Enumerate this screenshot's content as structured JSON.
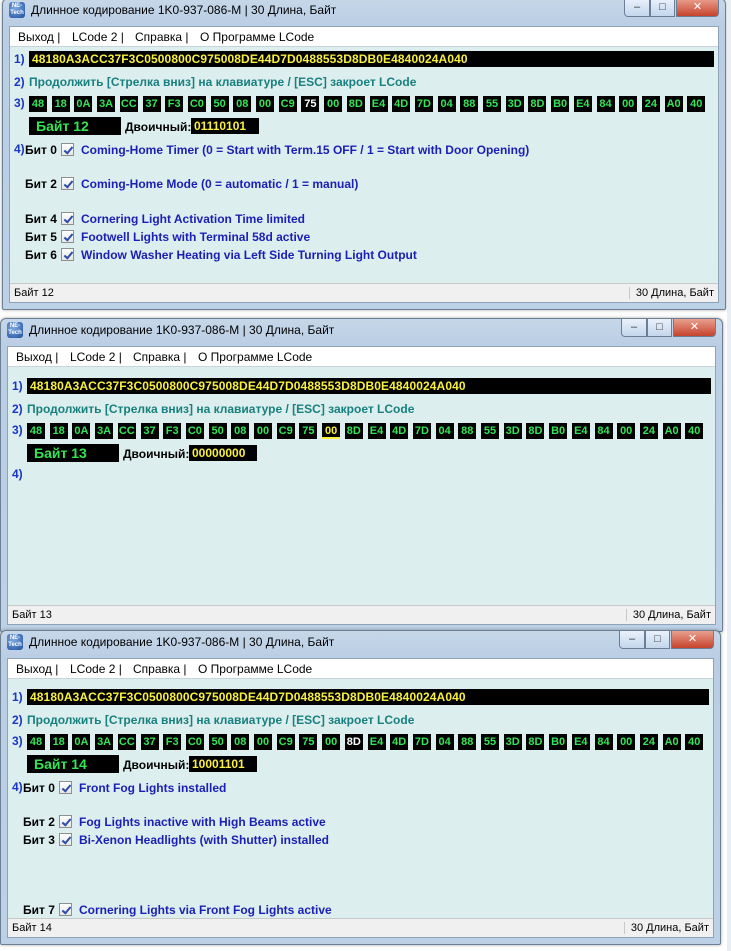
{
  "app": {
    "logo_text": "NE-Tech",
    "title": "Длинное кодирование  1K0-937-086-M | 30 Длина, Байт",
    "controls": {
      "minimize": "–",
      "maximize": "□",
      "close": "✕"
    }
  },
  "menu": {
    "file": "Выход |",
    "lcode2": "LCode 2 |",
    "help": "Справка |",
    "about": "О Программе LCode"
  },
  "labels": {
    "step1": "1)",
    "step2": "2)",
    "step3": "3)",
    "step4": "4)",
    "hint": "Продолжить [Стрелка вниз] на клавиатуре / [ESC] закроет LCode",
    "binary": "Двоичный:",
    "status_right": "30 Длина, Байт"
  },
  "coding_string": "48180A3ACC37F3C0500800C975008DE44D7D0488553D8DB0E4840024A040",
  "bytes": [
    "48",
    "18",
    "0A",
    "3A",
    "CC",
    "37",
    "F3",
    "C0",
    "50",
    "08",
    "00",
    "C9",
    "75",
    "00",
    "8D",
    "E4",
    "4D",
    "7D",
    "04",
    "88",
    "55",
    "3D",
    "8D",
    "B0",
    "E4",
    "84",
    "00",
    "24",
    "A0",
    "40"
  ],
  "windows": [
    {
      "byte_label": "Байт 12",
      "binary": "01110101",
      "status": "Байт 12",
      "bits": [
        {
          "label": "Бит 0",
          "desc": "Coming-Home Timer (0 = Start with Term.15 OFF / 1 = Start with Door Opening)"
        },
        {
          "label": "Бит 2",
          "desc": "Coming-Home Mode (0 = automatic / 1 = manual)"
        },
        {
          "label": "Бит 4",
          "desc": "Cornering Light Activation Time limited"
        },
        {
          "label": "Бит 5",
          "desc": "Footwell Lights with Terminal 58d active"
        },
        {
          "label": "Бит 6",
          "desc": "Window Washer Heating via Left Side Turning Light Output"
        }
      ]
    },
    {
      "byte_label": "Байт 13",
      "binary": "00000000",
      "status": "Байт 13",
      "bits": []
    },
    {
      "byte_label": "Байт 14",
      "binary": "10001101",
      "status": "Байт 14",
      "bits": [
        {
          "label": "Бит 0",
          "desc": "Front Fog Lights installed"
        },
        {
          "label": "Бит 2",
          "desc": "Fog Lights inactive with High Beams active"
        },
        {
          "label": "Бит 3",
          "desc": "Bi-Xenon Headlights (with Shutter) installed"
        },
        {
          "label": "Бит 7",
          "desc": "Cornering Lights via Front Fog Lights active"
        }
      ]
    }
  ],
  "colors": {
    "accent_text": "#1a35c8",
    "hint_text": "#18807e",
    "hex_yellow": "#f8ef3f",
    "byte_green": "#33e455"
  }
}
